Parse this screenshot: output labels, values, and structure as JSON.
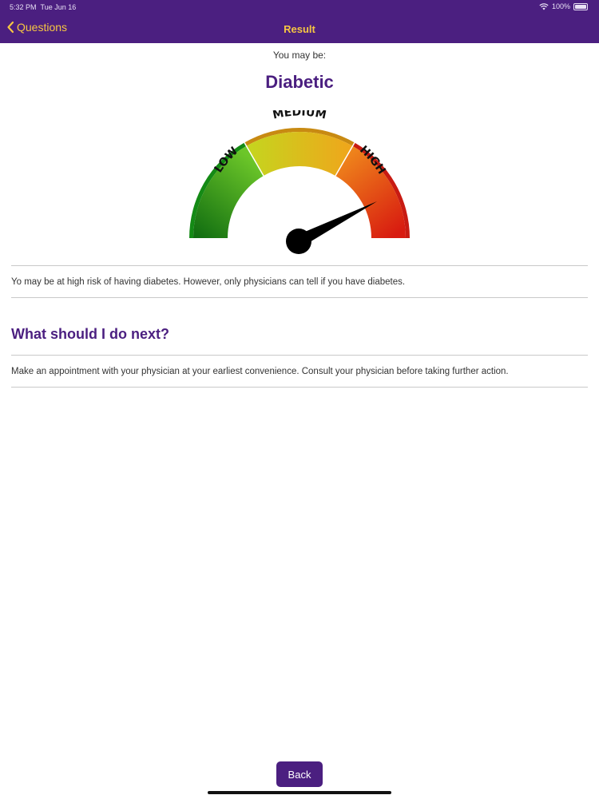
{
  "status_bar": {
    "time": "5:32 PM",
    "date": "Tue Jun 16",
    "battery": "100%"
  },
  "nav": {
    "back_label": "Questions",
    "title": "Result"
  },
  "result": {
    "subtitle": "You may be:",
    "title": "Diabetic"
  },
  "gauge": {
    "labels": {
      "low": "LOW",
      "medium": "MEDIUM",
      "high": "HIGH"
    },
    "level": 0.85,
    "colors": {
      "low": "#1f9e1c",
      "medium": "#e8b40e",
      "high": "#d42a16"
    }
  },
  "risk_text": "Yo may be at high risk of having diabetes. However, only physicians can tell if you have diabetes.",
  "next_steps": {
    "heading": "What should I do next?",
    "text": "Make an appointment with your physician at your earliest convenience. Consult your physician before taking further action."
  },
  "footer": {
    "back_label": "Back"
  },
  "theme": {
    "primary": "#4b1f80",
    "accent": "#f6c642"
  }
}
